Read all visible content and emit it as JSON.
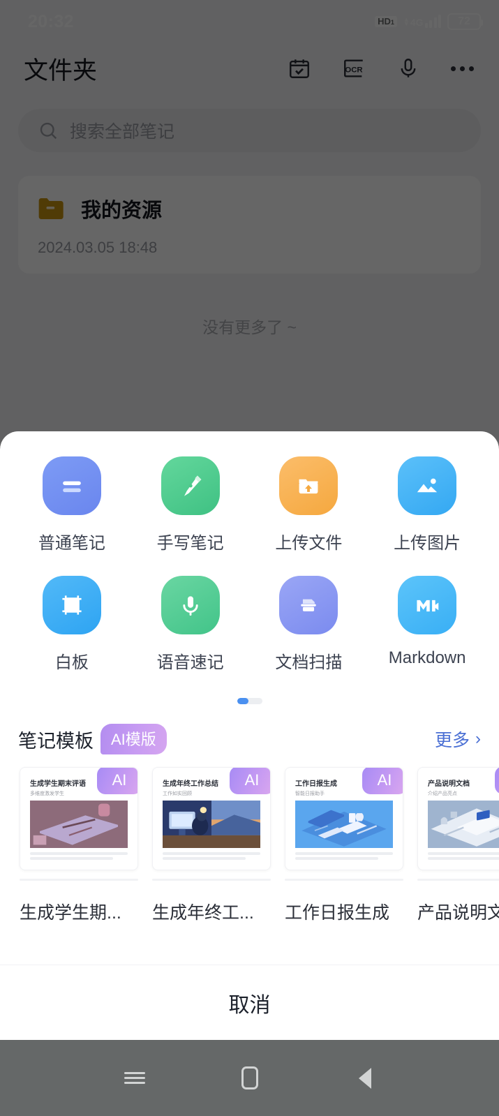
{
  "status_bar": {
    "time": "20:32",
    "hd_label": "HD",
    "hd_sub": "1",
    "network": "4G",
    "battery_level": "72",
    "signal_bars": 4
  },
  "app_header": {
    "title": "文件夹",
    "icons": [
      {
        "name": "calendar-check-icon",
        "label": "日历"
      },
      {
        "name": "ocr-icon",
        "label": "OCR"
      },
      {
        "name": "microphone-icon",
        "label": "语音"
      },
      {
        "name": "more-icon",
        "label": "更多"
      }
    ]
  },
  "search": {
    "placeholder": "搜索全部笔记",
    "icon": "search-icon"
  },
  "folder_list": {
    "items": [
      {
        "icon": "folder-icon",
        "name": "我的资源",
        "date": "2024.03.05 18:48"
      }
    ],
    "end_text": "没有更多了 ~"
  },
  "sheet": {
    "actions": [
      {
        "label": "普通笔记",
        "icon": "note-lines-icon",
        "color": "#6d8cf0",
        "color2": "#8098f5"
      },
      {
        "label": "手写笔记",
        "icon": "pen-nib-icon",
        "color": "#4cc98a",
        "color2": "#62d39a"
      },
      {
        "label": "上传文件",
        "icon": "folder-upload-icon",
        "color": "#f8b04f",
        "color2": "#fbbf66"
      },
      {
        "label": "上传图片",
        "icon": "image-icon",
        "color": "#44b2f5",
        "color2": "#5dbdf8"
      },
      {
        "label": "白板",
        "icon": "whiteboard-icon",
        "color": "#3cabf5",
        "color2": "#4fb7f8"
      },
      {
        "label": "语音速记",
        "icon": "microphone-icon",
        "color": "#4cc98a",
        "color2": "#66d49e"
      },
      {
        "label": "文档扫描",
        "icon": "doc-scan-icon",
        "color": "#8f9df2",
        "color2": "#7f8ef0"
      },
      {
        "label": "Markdown",
        "icon": "markdown-icon",
        "color": "#4cb6f7",
        "color2": "#5ec3f9"
      }
    ],
    "pager": {
      "pages": 2,
      "active": 0
    },
    "templates_header": {
      "title": "笔记模板",
      "badge": "AI模版",
      "more_label": "更多",
      "more_chevron": "›"
    },
    "templates": [
      {
        "caption": "生成学生期...",
        "thumb_title": "生成学生期末评语",
        "thumb_sub": "多维度激发学生",
        "ai_tag": "AI",
        "image_tone": "purple"
      },
      {
        "caption": "生成年终工...",
        "thumb_title": "生成年终工作总结",
        "thumb_sub": "工作如实回顾",
        "ai_tag": "AI",
        "image_tone": "blue-night"
      },
      {
        "caption": "工作日报生成",
        "thumb_title": "工作日报生成",
        "thumb_sub": "智能日报助手",
        "ai_tag": "AI",
        "image_tone": "blue-iso"
      },
      {
        "caption": "产品说明文",
        "thumb_title": "产品说明文档",
        "thumb_sub": "介绍产品亮点",
        "ai_tag": "AI",
        "image_tone": "grey-blue"
      }
    ],
    "cancel_label": "取消"
  },
  "nav_bar": {
    "buttons": [
      {
        "name": "recents-button",
        "label": "最近任务"
      },
      {
        "name": "home-button",
        "label": "主页"
      },
      {
        "name": "back-button",
        "label": "返回"
      }
    ]
  },
  "colors": {
    "accent_blue": "#4a90f0",
    "link_blue": "#4a6fd4",
    "ai_purple": "#b38df0",
    "folder_amber": "#c8930f",
    "scrim": "rgba(0,0,0,0.60)"
  }
}
